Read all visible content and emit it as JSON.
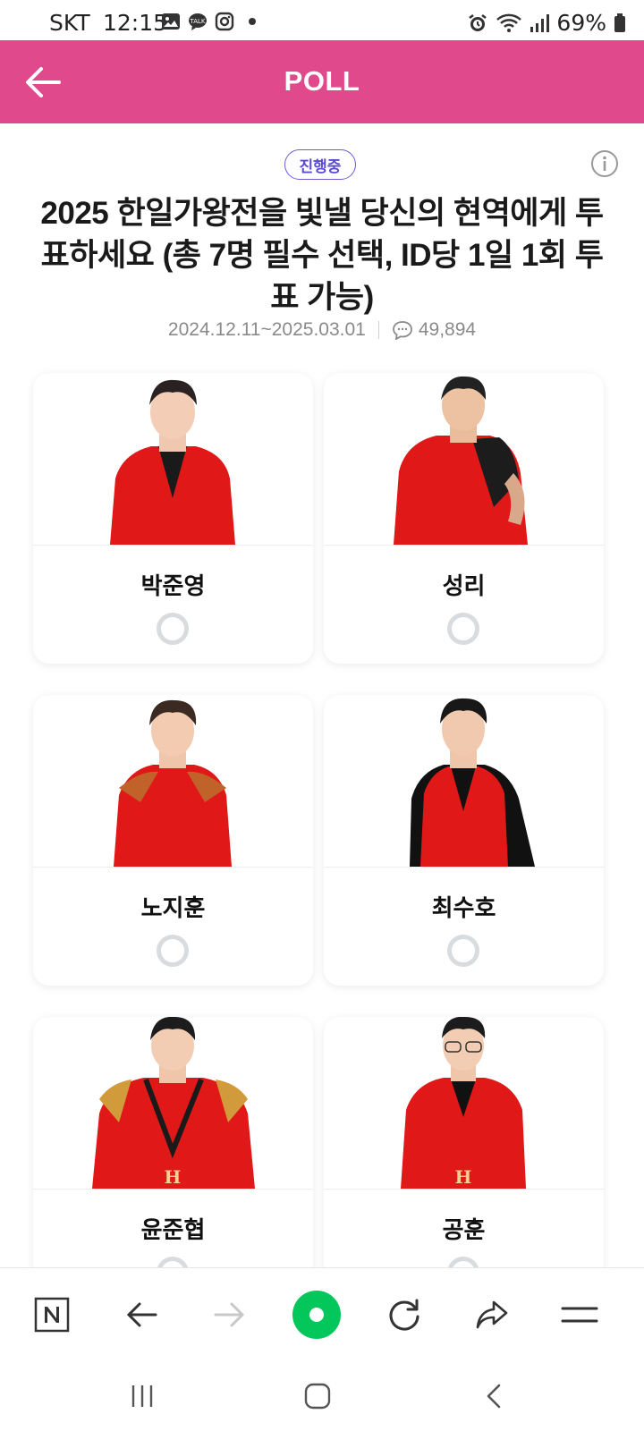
{
  "status_bar": {
    "carrier": "SKT",
    "time": "12:15",
    "battery": "69%"
  },
  "header": {
    "title": "POLL"
  },
  "poll": {
    "status_badge": "진행중",
    "title": "2025 한일가왕전을 빛낼 당신의 현역에게 투표하세요 (총 7명 필수 선택, ID당 1일 1회 투표 가능)",
    "period": "2024.12.11~2025.03.01",
    "comment_count": "49,894"
  },
  "candidates": [
    {
      "name": "박준영"
    },
    {
      "name": "성리"
    },
    {
      "name": "노지훈"
    },
    {
      "name": "최수호"
    },
    {
      "name": "윤준협"
    },
    {
      "name": "공훈"
    }
  ],
  "colors": {
    "header_bg": "#e0498b",
    "badge": "#5a4bd0",
    "radio": "#d9dcdf",
    "naver_green": "#03c75a"
  }
}
